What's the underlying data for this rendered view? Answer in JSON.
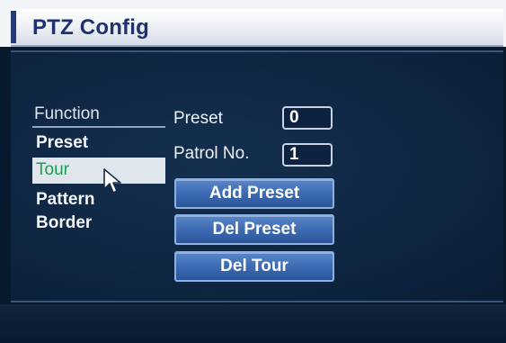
{
  "window": {
    "title": "PTZ Config"
  },
  "function_menu": {
    "header": "Function",
    "items": [
      {
        "label": "Preset",
        "selected": false
      },
      {
        "label": "Tour",
        "selected": true
      },
      {
        "label": "Pattern",
        "selected": false
      },
      {
        "label": "Border",
        "selected": false
      }
    ]
  },
  "fields": {
    "preset": {
      "label": "Preset",
      "value": "0"
    },
    "patrol_no": {
      "label": "Patrol No.",
      "value": "1"
    }
  },
  "buttons": {
    "add_preset": "Add Preset",
    "del_preset": "Del Preset",
    "del_tour": "Del Tour"
  },
  "icons": {
    "pointer": "mouse-pointer-icon"
  },
  "colors": {
    "title_text": "#1f3270",
    "panel_bg": "#0e2541",
    "button_blue": "#3f6db5",
    "selected_text": "#1aa04f"
  }
}
